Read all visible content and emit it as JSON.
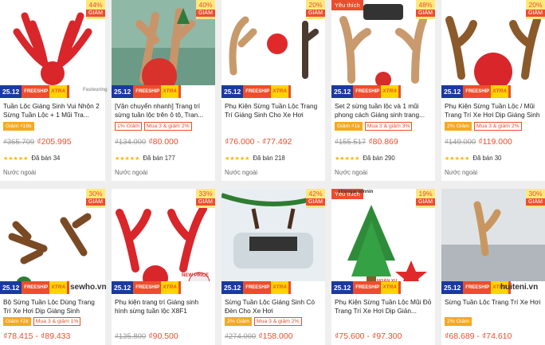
{
  "promo": {
    "date": "25.12",
    "freeship": "FREESHIP",
    "xtra": "XTRA"
  },
  "discount_word": "GIẢM",
  "fav_label": "Yêu thích",
  "products": [
    {
      "title": "Tuần Lộc Giáng Sinh Vui Nhộn 2 Sừng Tuần Lộc + 1 Mũi Tra...",
      "tags": [
        {
          "t": "Giảm ₫16k",
          "k": "filled"
        }
      ],
      "old": "₫365.709",
      "price": "₫205.995",
      "stars": "★★★★★",
      "sold": "Đã bán 34",
      "loc": "Nước ngoài",
      "disc": "44%",
      "fav": false
    },
    {
      "title": "[Vận chuyển nhanh] Trang trí sừng tuần lộc trên ô tô, Tran...",
      "tags": [
        {
          "t": "1% Giảm",
          "k": "out"
        },
        {
          "t": "Mua 3 & giảm 2%",
          "k": "out"
        }
      ],
      "old": "₫134.000",
      "price": "₫80.000",
      "stars": "★★★★★",
      "sold": "Đã bán 177",
      "loc": "Nước ngoài",
      "disc": "40%",
      "fav": false
    },
    {
      "title": "Phụ Kiện Sừng Tuần Lộc Trang Trí Giáng Sinh Cho Xe Hơi",
      "tags": [],
      "old": "",
      "price": "₫76.000 - ₫77.492",
      "stars": "★★★★★",
      "sold": "Đã bán 218",
      "loc": "Nước ngoài",
      "disc": "20%",
      "fav": false
    },
    {
      "title": "Set 2 sừng tuần lộc và 1 mũi phong cách Giáng sinh trang...",
      "tags": [
        {
          "t": "Giảm ₫1k",
          "k": "filled"
        },
        {
          "t": "Mua 3 & giảm 3%",
          "k": "out"
        }
      ],
      "old": "₫155.517",
      "price": "₫80.869",
      "stars": "★★★★★",
      "sold": "Đã bán 290",
      "loc": "Nước ngoài",
      "disc": "48%",
      "fav": true
    },
    {
      "title": "Phụ Kiện Sừng Tuần Lộc / Mũi Trang Trí Xe Hơi Dịp Giáng Sinh",
      "tags": [
        {
          "t": "2% Giảm",
          "k": "filled"
        },
        {
          "t": "Mua 3 & giảm 2%",
          "k": "out"
        }
      ],
      "old": "₫149.000",
      "price": "₫119.000",
      "stars": "★★★★★",
      "sold": "Đã bán 30",
      "loc": "Nước ngoài",
      "disc": "20%",
      "fav": false
    },
    {
      "title": "Bộ Sừng Tuần Lộc Dùng Trang Trí Xe Hơi Dịp Giáng Sinh",
      "tags": [
        {
          "t": "Giảm ₫2k",
          "k": "filled"
        },
        {
          "t": "Mua 3 & giảm 1%",
          "k": "out"
        }
      ],
      "old": "",
      "price": "₫78.415 - ₫89.433",
      "disc": "30%",
      "fav": false
    },
    {
      "title": "Phụ kiện trang trí Giáng sinh hình sừng tuần lộc X8F1",
      "tags": [],
      "old": "₫135.800",
      "price": "₫90.500",
      "disc": "33%",
      "fav": false
    },
    {
      "title": "Sừng Tuần Lộc Giáng Sinh Có Đèn Cho Xe Hơi",
      "tags": [
        {
          "t": "2% Giảm",
          "k": "filled"
        },
        {
          "t": "Mua 3 & giảm 2%",
          "k": "out"
        }
      ],
      "old": "₫274.000",
      "price": "₫158.000",
      "disc": "42%",
      "fav": false
    },
    {
      "title": "Phụ Kiện Sừng Tuần Lộc Mũi Đỏ Trang Trí Xe Hơi Dịp Giản...",
      "tags": [],
      "old": "",
      "price": "₫75.600 - ₫97.300",
      "disc": "19%",
      "fav": true
    },
    {
      "title": "Sừng Tuần Lộc Trang Trí Xe Hơi",
      "tags": [
        {
          "t": "2% Giảm",
          "k": "filled"
        }
      ],
      "old": "",
      "price": "₫68.689 - ₫74.610",
      "disc": "30%",
      "fav": false
    }
  ],
  "watermarks": {
    "left": "sewho.vn",
    "right": "huiteni.vn"
  },
  "image_captions": {
    "p0": "Fasteuring",
    "p5": "sewho.vn",
    "p6": "NEW PRICE",
    "p7": "strongaroonnin",
    "p8": "HOÀN XU"
  }
}
